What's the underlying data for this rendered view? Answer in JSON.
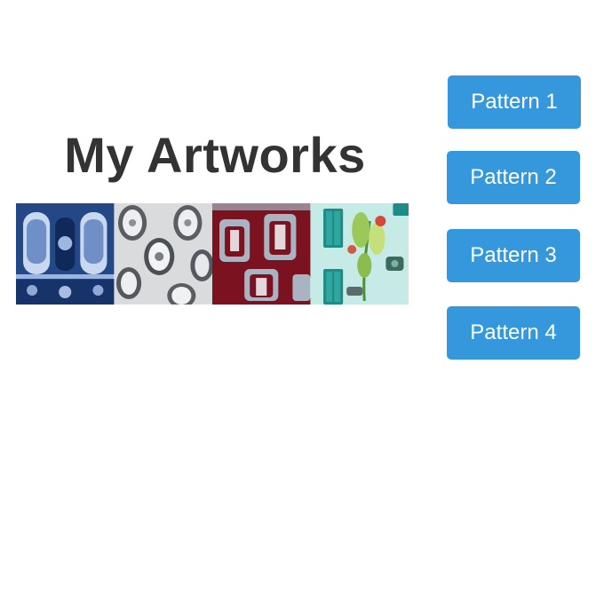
{
  "title": "My Artworks",
  "thumbnails": [
    {
      "icon": "blue-toile-pattern",
      "color": "#1e3f7a"
    },
    {
      "icon": "gray-cameo-pattern",
      "color": "#7f8389"
    },
    {
      "icon": "red-frame-pattern",
      "color": "#7a1220"
    },
    {
      "icon": "green-botanical-pattern",
      "color": "#b9e4df"
    }
  ],
  "buttons": [
    {
      "label": "Pattern 1"
    },
    {
      "label": "Pattern 2"
    },
    {
      "label": "Pattern 3"
    },
    {
      "label": "Pattern 4"
    }
  ],
  "colors": {
    "accent": "#3598dc",
    "title": "#333333",
    "background": "#ffffff"
  }
}
